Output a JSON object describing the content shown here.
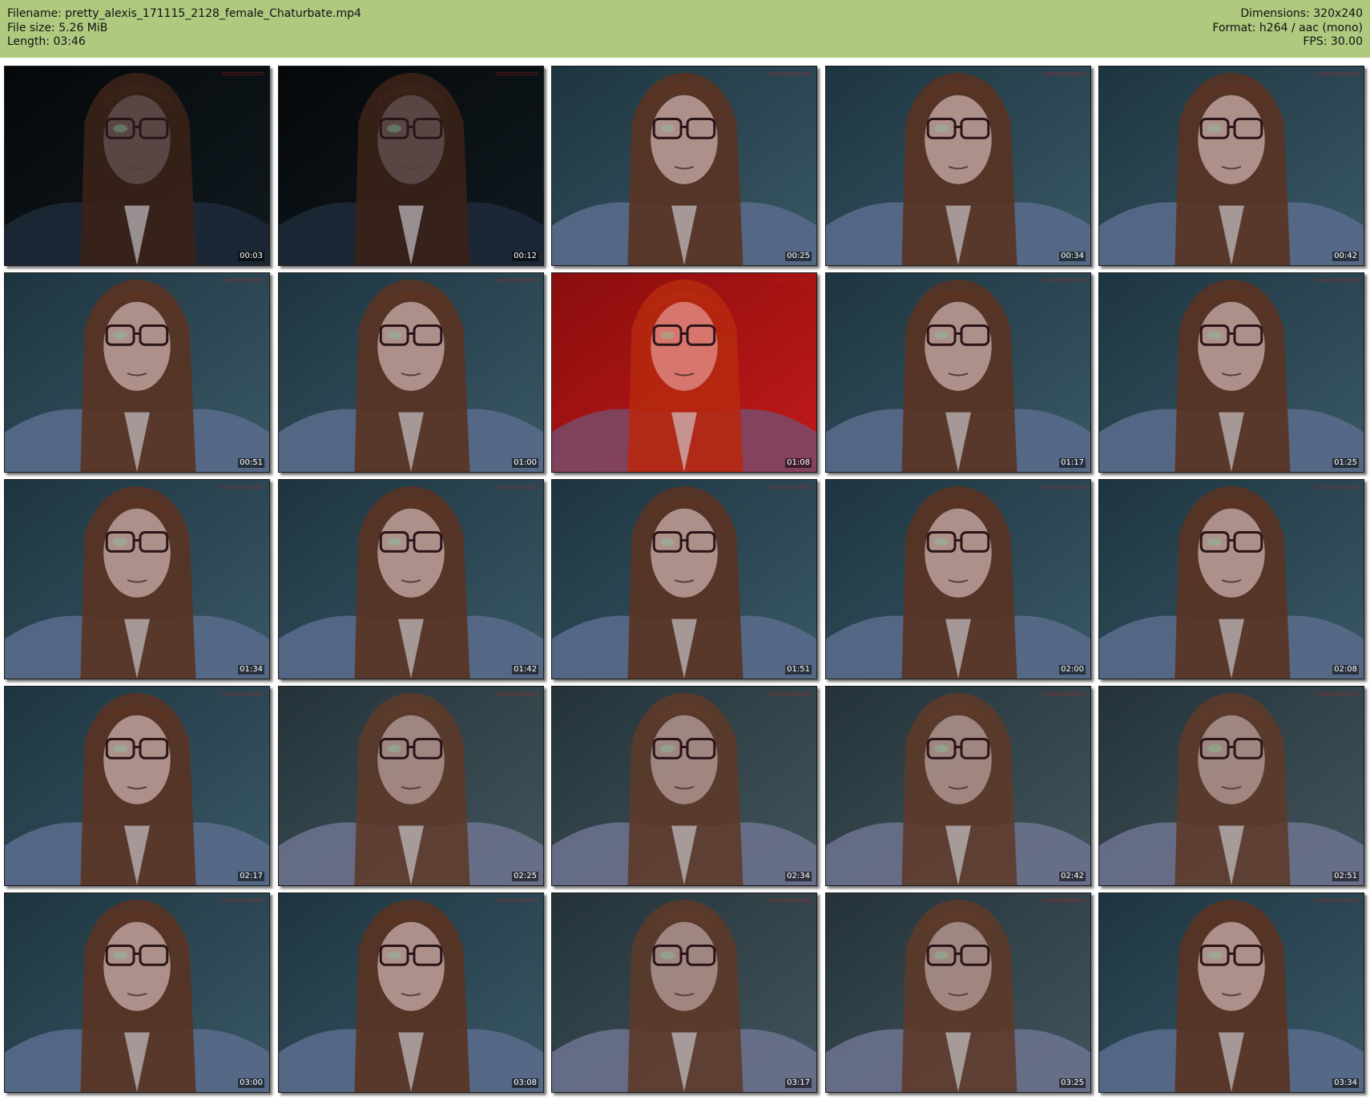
{
  "header": {
    "filename": "Filename: pretty_alexis_171115_2128_female_Chaturbate.mp4",
    "filesize": "File size: 5.26 MiB",
    "length": "Length: 03:46",
    "dimensions": "Dimensions: 320x240",
    "format": "Format: h264 / aac (mono)",
    "fps": "FPS: 30.00"
  },
  "colors": {
    "header_bg": "#afc97f",
    "page_bg": "#ffffff"
  },
  "thumbnails": [
    {
      "time": "00:03",
      "tone": "dark"
    },
    {
      "time": "00:12",
      "tone": "dark"
    },
    {
      "time": "00:25",
      "tone": "teal"
    },
    {
      "time": "00:34",
      "tone": "teal"
    },
    {
      "time": "00:42",
      "tone": "teal"
    },
    {
      "time": "00:51",
      "tone": "teal"
    },
    {
      "time": "01:00",
      "tone": "teal"
    },
    {
      "time": "01:08",
      "tone": "red"
    },
    {
      "time": "01:17",
      "tone": "teal"
    },
    {
      "time": "01:25",
      "tone": "teal"
    },
    {
      "time": "01:34",
      "tone": "teal"
    },
    {
      "time": "01:42",
      "tone": "teal"
    },
    {
      "time": "01:51",
      "tone": "teal"
    },
    {
      "time": "02:00",
      "tone": "teal"
    },
    {
      "time": "02:08",
      "tone": "teal"
    },
    {
      "time": "02:17",
      "tone": "teal"
    },
    {
      "time": "02:25",
      "tone": "dim"
    },
    {
      "time": "02:34",
      "tone": "dim"
    },
    {
      "time": "02:42",
      "tone": "dim"
    },
    {
      "time": "02:51",
      "tone": "dim"
    },
    {
      "time": "03:00",
      "tone": "teal"
    },
    {
      "time": "03:08",
      "tone": "teal"
    },
    {
      "time": "03:17",
      "tone": "dim"
    },
    {
      "time": "03:25",
      "tone": "dim"
    },
    {
      "time": "03:34",
      "tone": "teal"
    }
  ]
}
